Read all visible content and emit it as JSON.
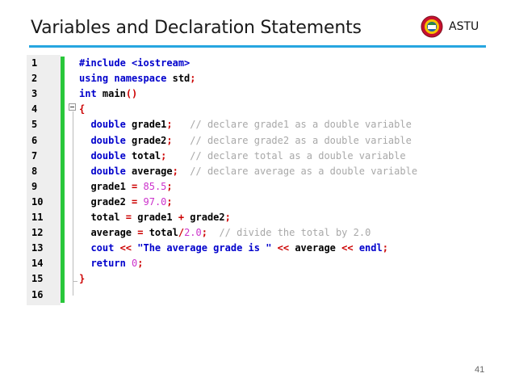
{
  "header": {
    "title": "Variables and Declaration Statements",
    "brand": "ASTU",
    "rule_color": "#27a6e0"
  },
  "code": {
    "lines": [
      {
        "n": "1",
        "tokens": [
          [
            "pp",
            "#include <iostream>"
          ]
        ]
      },
      {
        "n": "2",
        "tokens": [
          [
            "kw",
            "using namespace"
          ],
          [
            "id",
            " std"
          ],
          [
            "op",
            ";"
          ]
        ]
      },
      {
        "n": "3",
        "tokens": [
          [
            "kw",
            "int"
          ],
          [
            "id",
            " main"
          ],
          [
            "op",
            "()"
          ]
        ]
      },
      {
        "n": "4",
        "tokens": [
          [
            "op",
            "{"
          ]
        ]
      },
      {
        "n": "5",
        "tokens": [
          [
            "kw",
            "  double"
          ],
          [
            "id",
            " grade1"
          ],
          [
            "op",
            ";"
          ],
          [
            "cm",
            "   // declare grade1 as a double variable"
          ]
        ]
      },
      {
        "n": "6",
        "tokens": [
          [
            "kw",
            "  double"
          ],
          [
            "id",
            " grade2"
          ],
          [
            "op",
            ";"
          ],
          [
            "cm",
            "   // declare grade2 as a double variable"
          ]
        ]
      },
      {
        "n": "7",
        "tokens": [
          [
            "kw",
            "  double"
          ],
          [
            "id",
            " total"
          ],
          [
            "op",
            ";"
          ],
          [
            "cm",
            "    // declare total as a double variable"
          ]
        ]
      },
      {
        "n": "8",
        "tokens": [
          [
            "kw",
            "  double"
          ],
          [
            "id",
            " average"
          ],
          [
            "op",
            ";"
          ],
          [
            "cm",
            "  // declare average as a double variable"
          ]
        ]
      },
      {
        "n": "9",
        "tokens": [
          [
            "id",
            "  grade1 "
          ],
          [
            "op",
            "="
          ],
          [
            "num",
            " 85.5"
          ],
          [
            "op",
            ";"
          ]
        ]
      },
      {
        "n": "10",
        "tokens": [
          [
            "id",
            "  grade2 "
          ],
          [
            "op",
            "="
          ],
          [
            "num",
            " 97.0"
          ],
          [
            "op",
            ";"
          ]
        ]
      },
      {
        "n": "11",
        "tokens": [
          [
            "id",
            "  total "
          ],
          [
            "op",
            "="
          ],
          [
            "id",
            " grade1 "
          ],
          [
            "op",
            "+"
          ],
          [
            "id",
            " grade2"
          ],
          [
            "op",
            ";"
          ]
        ]
      },
      {
        "n": "12",
        "tokens": [
          [
            "id",
            "  average "
          ],
          [
            "op",
            "="
          ],
          [
            "id",
            " total"
          ],
          [
            "op",
            "/"
          ],
          [
            "num",
            "2.0"
          ],
          [
            "op",
            ";"
          ],
          [
            "cm",
            "  // divide the total by 2.0"
          ]
        ]
      },
      {
        "n": "13",
        "tokens": [
          [
            "kw",
            "  cout "
          ],
          [
            "op",
            "<<"
          ],
          [
            "str",
            " \"The average grade is \" "
          ],
          [
            "op",
            "<<"
          ],
          [
            "id",
            " average "
          ],
          [
            "op",
            "<<"
          ],
          [
            "kw",
            " endl"
          ],
          [
            "op",
            ";"
          ]
        ]
      },
      {
        "n": "14",
        "tokens": [
          [
            "kw",
            "  return"
          ],
          [
            "num",
            " 0"
          ],
          [
            "op",
            ";"
          ]
        ]
      },
      {
        "n": "15",
        "tokens": [
          [
            "op",
            "}"
          ]
        ]
      },
      {
        "n": "16",
        "tokens": []
      }
    ]
  },
  "footer": {
    "page_number": "41"
  }
}
